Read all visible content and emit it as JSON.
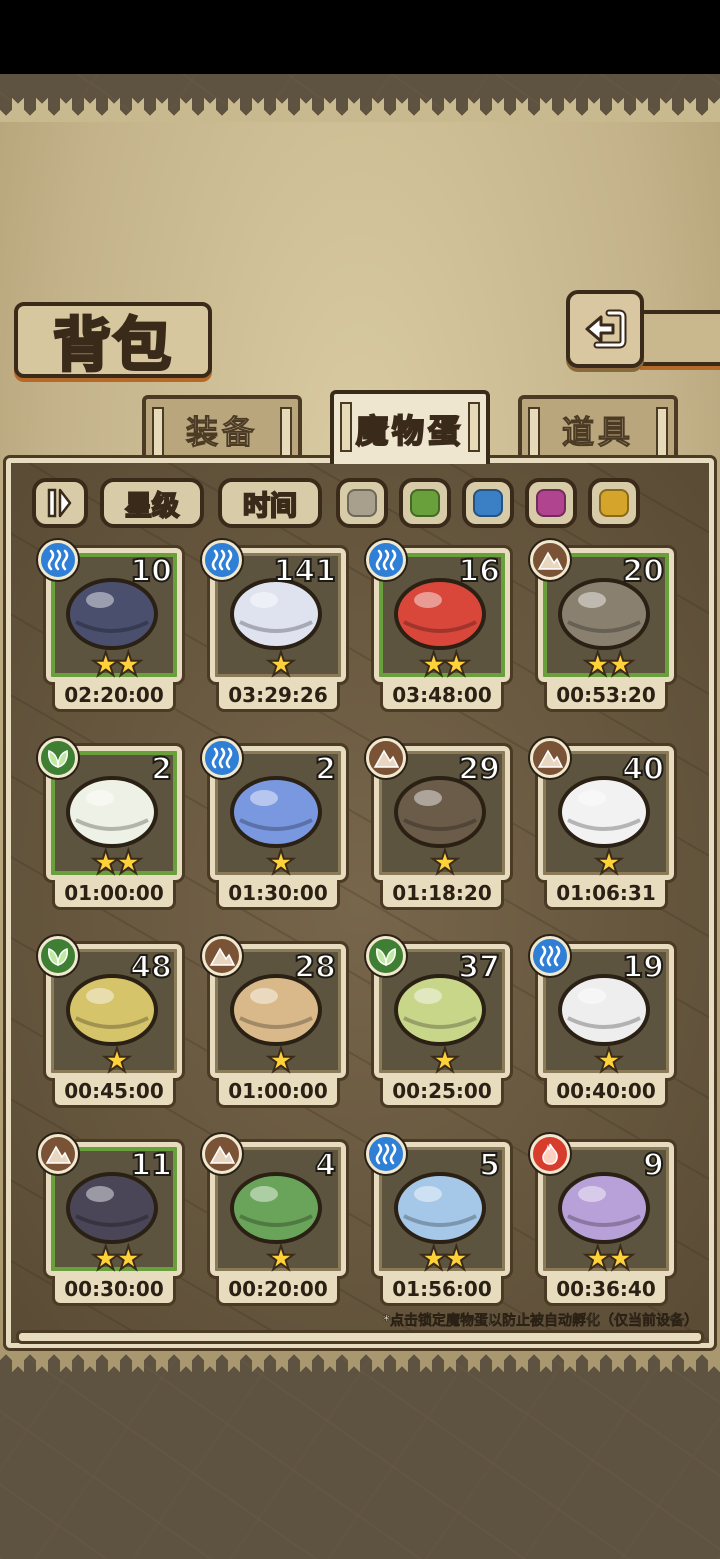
{
  "header": {
    "title": "背包"
  },
  "tabs": [
    {
      "label": "装备",
      "active": false
    },
    {
      "label": "魔物蛋",
      "active": true
    },
    {
      "label": "道具",
      "active": false
    }
  ],
  "filters": {
    "star_label": "星级",
    "time_label": "时间",
    "color_swatches": [
      "#a8a08c",
      "#6aa03c",
      "#3b7fc4",
      "#b0448e",
      "#d4a52a"
    ]
  },
  "eggs": [
    {
      "element": "water",
      "count": "10",
      "stars": "★★",
      "timer": "02:20:00",
      "frame": "green",
      "color": "#4a4f6e"
    },
    {
      "element": "water",
      "count": "141",
      "stars": "★",
      "timer": "03:29:26",
      "frame": "plain",
      "color": "#dfe3f0"
    },
    {
      "element": "water",
      "count": "16",
      "stars": "★★",
      "timer": "03:48:00",
      "frame": "green",
      "color": "#d8473a"
    },
    {
      "element": "earth",
      "count": "20",
      "stars": "★★",
      "timer": "00:53:20",
      "frame": "green",
      "color": "#8a8070"
    },
    {
      "element": "grass",
      "count": "2",
      "stars": "★★",
      "timer": "01:00:00",
      "frame": "green",
      "color": "#eef2e6"
    },
    {
      "element": "water",
      "count": "2",
      "stars": "★",
      "timer": "01:30:00",
      "frame": "plain",
      "color": "#7a98e0"
    },
    {
      "element": "earth",
      "count": "29",
      "stars": "★",
      "timer": "01:18:20",
      "frame": "plain",
      "color": "#6b5c4a"
    },
    {
      "element": "earth",
      "count": "40",
      "stars": "★",
      "timer": "01:06:31",
      "frame": "plain",
      "color": "#f2f2f2"
    },
    {
      "element": "grass",
      "count": "48",
      "stars": "★",
      "timer": "00:45:00",
      "frame": "plain",
      "color": "#d6c46a"
    },
    {
      "element": "earth",
      "count": "28",
      "stars": "★",
      "timer": "01:00:00",
      "frame": "plain",
      "color": "#d9b98a"
    },
    {
      "element": "grass",
      "count": "37",
      "stars": "★",
      "timer": "00:25:00",
      "frame": "plain",
      "color": "#c8d68a"
    },
    {
      "element": "water",
      "count": "19",
      "stars": "★",
      "timer": "00:40:00",
      "frame": "plain",
      "color": "#eeeeee"
    },
    {
      "element": "earth",
      "count": "11",
      "stars": "★★",
      "timer": "00:30:00",
      "frame": "green",
      "color": "#4a4658"
    },
    {
      "element": "earth",
      "count": "4",
      "stars": "★",
      "timer": "00:20:00",
      "frame": "plain",
      "color": "#6aa45a"
    },
    {
      "element": "water",
      "count": "5",
      "stars": "★★",
      "timer": "01:56:00",
      "frame": "plain",
      "color": "#a6c8e8"
    },
    {
      "element": "fire",
      "count": "9",
      "stars": "★★",
      "timer": "00:36:40",
      "frame": "plain",
      "color": "#b8a0d8"
    }
  ],
  "hint": "*点击锁定魔物蛋以防止被自动孵化（仅当前设备）"
}
